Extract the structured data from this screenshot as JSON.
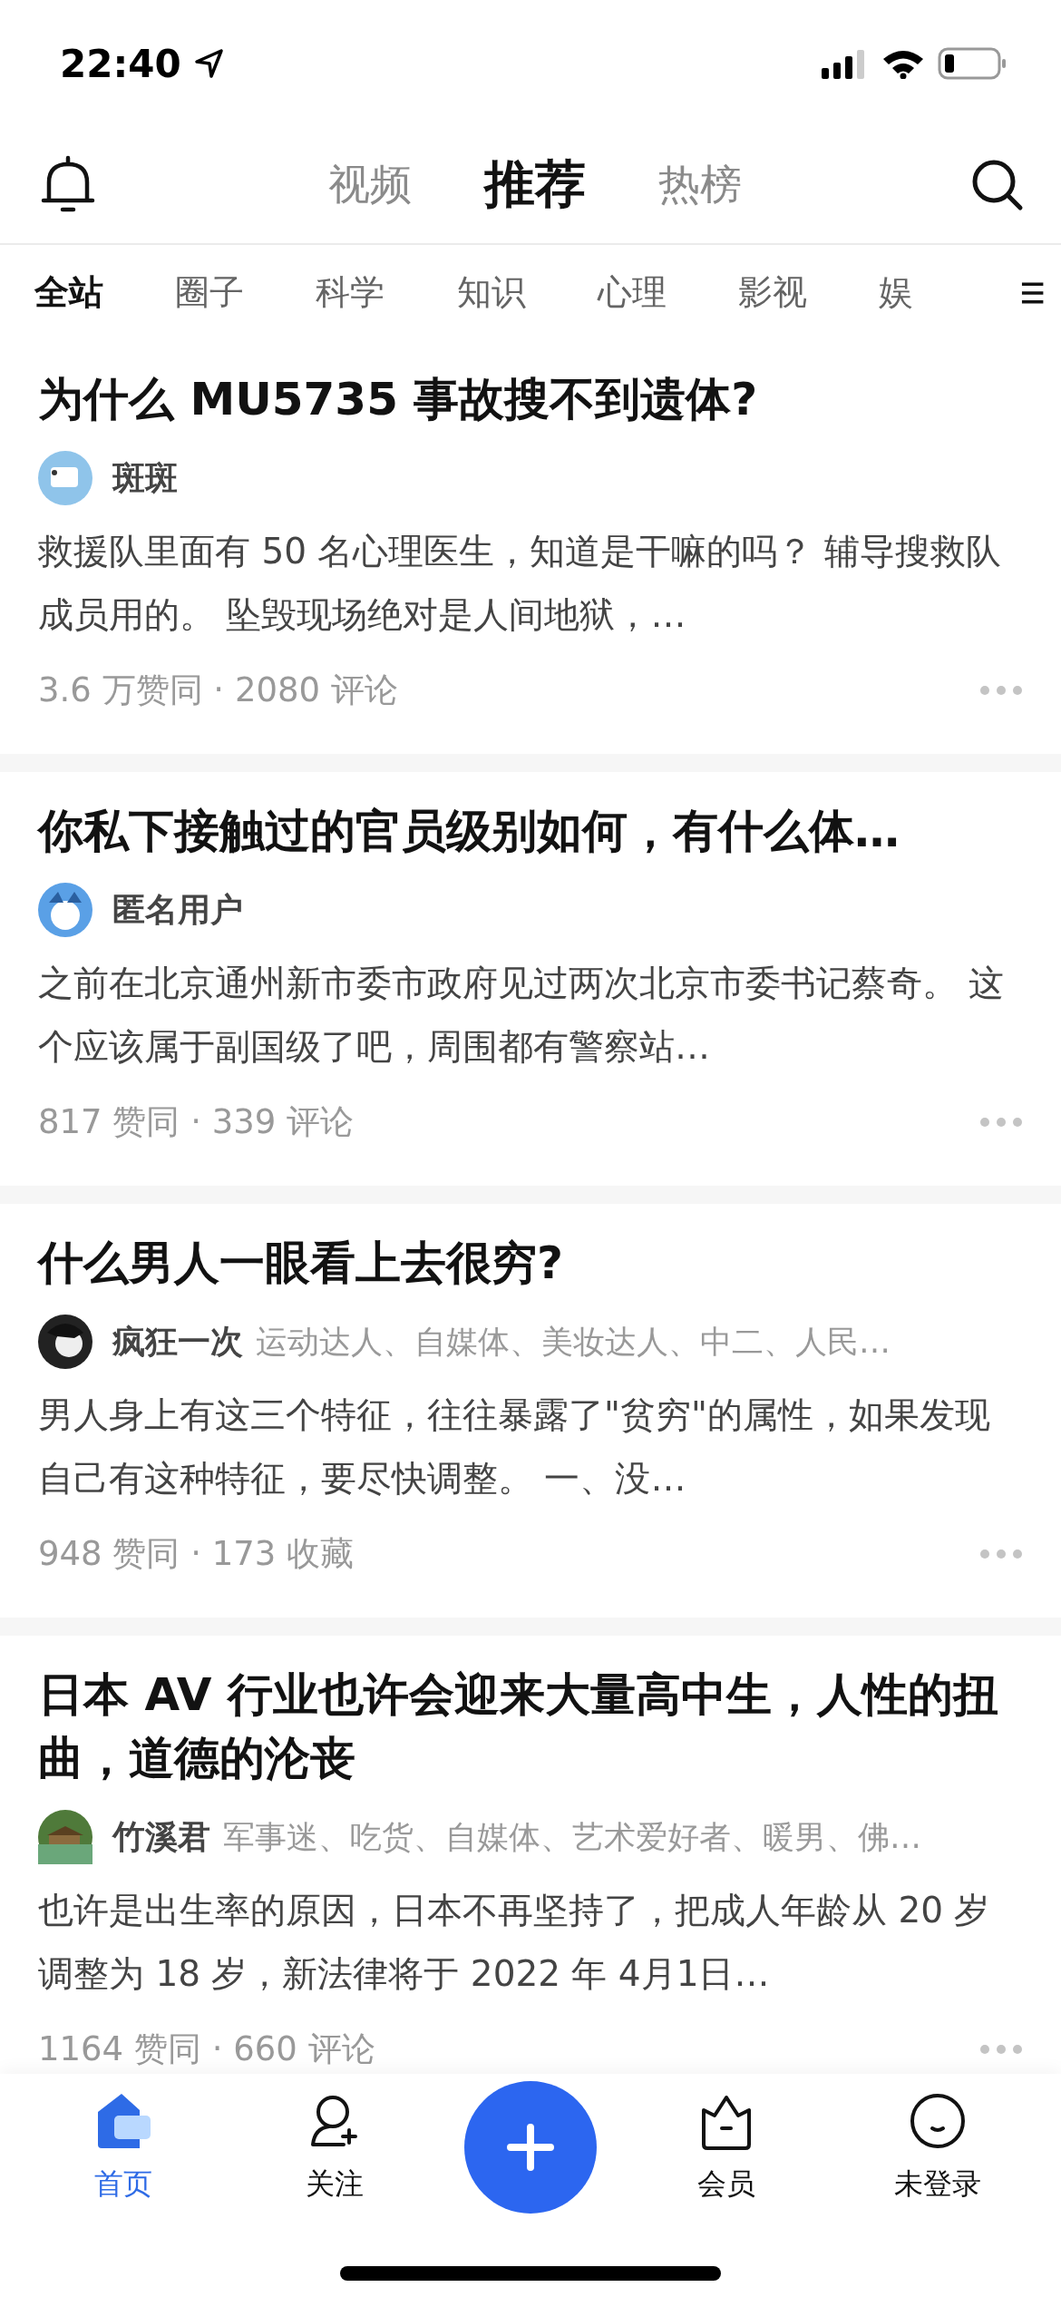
{
  "status_bar": {
    "time": "22:40"
  },
  "header": {
    "tabs": [
      {
        "label": "视频",
        "selected": false
      },
      {
        "label": "推荐",
        "selected": true
      },
      {
        "label": "热榜",
        "selected": false
      }
    ]
  },
  "categories": [
    {
      "label": "全站",
      "selected": true
    },
    {
      "label": "圈子",
      "selected": false
    },
    {
      "label": "科学",
      "selected": false
    },
    {
      "label": "知识",
      "selected": false
    },
    {
      "label": "心理",
      "selected": false
    },
    {
      "label": "影视",
      "selected": false
    },
    {
      "label": "娱",
      "selected": false
    }
  ],
  "feed": [
    {
      "title": "为什么 MU5735 事故搜不到遗体?",
      "author": {
        "name": "斑斑"
      },
      "excerpt": "救援队里面有 50 名心理医生，知道是干嘛的吗？ 辅导搜救队成员用的。 坠毁现场绝对是人间地狱，…",
      "stats": "3.6 万赞同 · 2080 评论"
    },
    {
      "title": "你私下接触过的官员级别如何，有什么体…",
      "author": {
        "name": "匿名用户"
      },
      "excerpt": "之前在北京通州新市委市政府见过两次北京市委书记蔡奇。 这个应该属于副国级了吧，周围都有警察站…",
      "stats": "817 赞同 · 339 评论"
    },
    {
      "title": "什么男人一眼看上去很穷?",
      "author": {
        "name": "疯狂一次",
        "tags": "运动达人、自媒体、美妆达人、中二、人民…"
      },
      "excerpt": "男人身上有这三个特征，往往暴露了\"贫穷\"的属性，如果发现自己有这种特征，要尽快调整。 一、没…",
      "stats": "948 赞同 · 173 收藏"
    },
    {
      "title": "日本 AV 行业也许会迎来大量高中生，人性的扭曲，道德的沦丧",
      "author": {
        "name": "竹溪君",
        "tags": "军事迷、吃货、自媒体、艺术爱好者、暖男、佛…"
      },
      "excerpt": "也许是出生率的原因，日本不再坚持了，把成人年龄从 20 岁调整为 18 岁，新法律将于 2022 年 4月1日…",
      "stats": "1164 赞同 · 660 评论"
    }
  ],
  "bottom_nav": [
    {
      "kind": "home",
      "label": "首页",
      "selected": true
    },
    {
      "kind": "follow",
      "label": "关注",
      "selected": false
    },
    {
      "kind": "add"
    },
    {
      "kind": "vip",
      "label": "会员",
      "selected": false
    },
    {
      "kind": "profile",
      "label": "未登录",
      "selected": false
    }
  ]
}
